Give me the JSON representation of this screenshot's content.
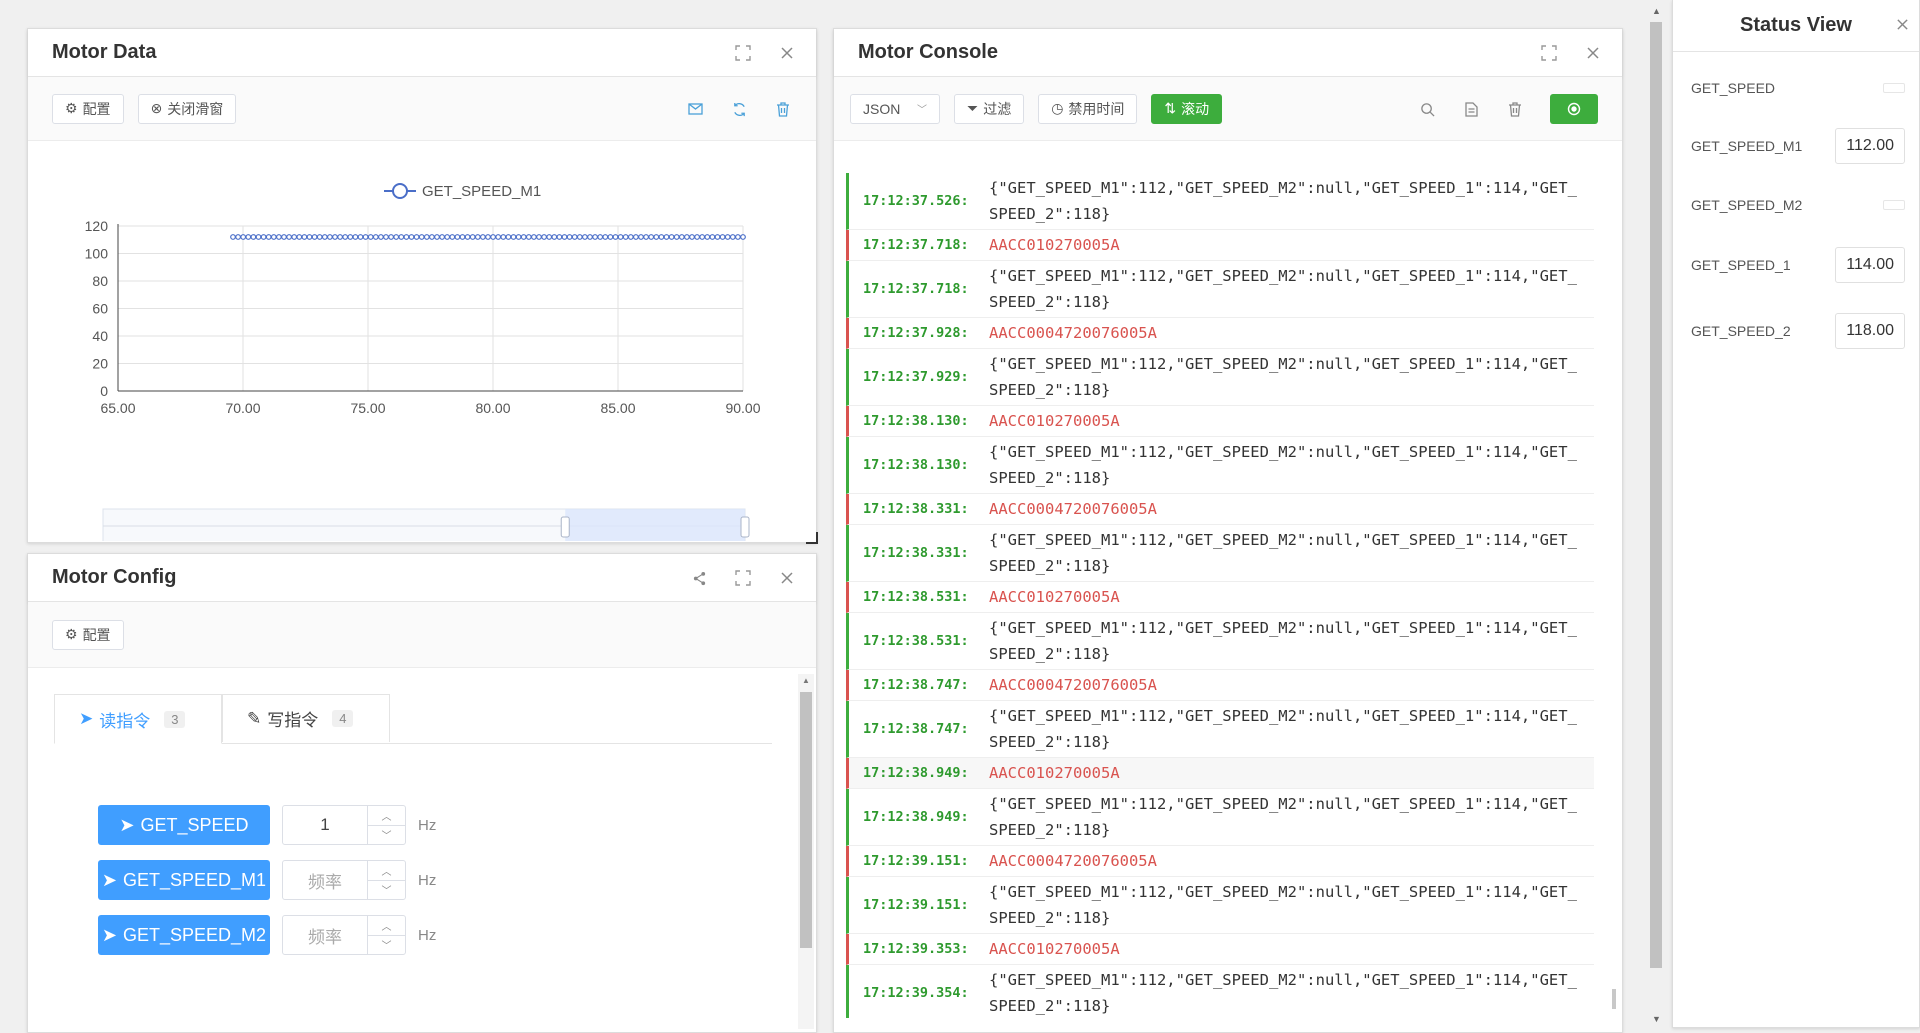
{
  "motor_data": {
    "title": "Motor Data",
    "btn_config": "配置",
    "btn_close_slider": "关闭滑窗"
  },
  "chart_data": {
    "type": "line",
    "legend": [
      "GET_SPEED_M1"
    ],
    "series": [
      {
        "name": "GET_SPEED_M1",
        "x_range": [
          69.6,
          90.0
        ],
        "value": 112,
        "points": 101
      }
    ],
    "xlim": [
      65,
      90
    ],
    "ylim": [
      0,
      120
    ],
    "x_ticks": [
      "65.00",
      "70.00",
      "75.00",
      "80.00",
      "85.00",
      "90.00"
    ],
    "y_ticks": [
      "0",
      "20",
      "40",
      "60",
      "80",
      "100",
      "120"
    ],
    "grid": true,
    "slider_range": [
      0.72,
      1.0
    ],
    "color": "#4a6ec8"
  },
  "motor_config": {
    "title": "Motor Config",
    "btn_config": "配置",
    "tabs": [
      {
        "label": "读指令",
        "count": "3"
      },
      {
        "label": "写指令",
        "count": "4"
      }
    ],
    "commands": [
      {
        "label": "GET_SPEED",
        "value": "1",
        "placeholder": "",
        "unit": "Hz"
      },
      {
        "label": "GET_SPEED_M1",
        "value": "",
        "placeholder": "频率",
        "unit": "Hz"
      },
      {
        "label": "GET_SPEED_M2",
        "value": "",
        "placeholder": "频率",
        "unit": "Hz"
      }
    ]
  },
  "console": {
    "title": "Motor Console",
    "format": "JSON",
    "btn_filter": "过滤",
    "btn_disable_time": "禁用时间",
    "btn_scroll": "滚动",
    "logs": [
      {
        "time": "17:12:37.526:",
        "msg": "{\"GET_SPEED_M1\":112,\"GET_SPEED_M2\":null,\"GET_SPEED_1\":114,\"GET_SPEED_2\":118}",
        "kind": "green"
      },
      {
        "time": "17:12:37.718:",
        "msg": "AACC010270005A",
        "kind": "red"
      },
      {
        "time": "17:12:37.718:",
        "msg": "{\"GET_SPEED_M1\":112,\"GET_SPEED_M2\":null,\"GET_SPEED_1\":114,\"GET_SPEED_2\":118}",
        "kind": "green"
      },
      {
        "time": "17:12:37.928:",
        "msg": "AACC0004720076005A",
        "kind": "red"
      },
      {
        "time": "17:12:37.929:",
        "msg": "{\"GET_SPEED_M1\":112,\"GET_SPEED_M2\":null,\"GET_SPEED_1\":114,\"GET_SPEED_2\":118}",
        "kind": "green"
      },
      {
        "time": "17:12:38.130:",
        "msg": "AACC010270005A",
        "kind": "red"
      },
      {
        "time": "17:12:38.130:",
        "msg": "{\"GET_SPEED_M1\":112,\"GET_SPEED_M2\":null,\"GET_SPEED_1\":114,\"GET_SPEED_2\":118}",
        "kind": "green"
      },
      {
        "time": "17:12:38.331:",
        "msg": "AACC0004720076005A",
        "kind": "red"
      },
      {
        "time": "17:12:38.331:",
        "msg": "{\"GET_SPEED_M1\":112,\"GET_SPEED_M2\":null,\"GET_SPEED_1\":114,\"GET_SPEED_2\":118}",
        "kind": "green"
      },
      {
        "time": "17:12:38.531:",
        "msg": "AACC010270005A",
        "kind": "red"
      },
      {
        "time": "17:12:38.531:",
        "msg": "{\"GET_SPEED_M1\":112,\"GET_SPEED_M2\":null,\"GET_SPEED_1\":114,\"GET_SPEED_2\":118}",
        "kind": "green"
      },
      {
        "time": "17:12:38.747:",
        "msg": "AACC0004720076005A",
        "kind": "red"
      },
      {
        "time": "17:12:38.747:",
        "msg": "{\"GET_SPEED_M1\":112,\"GET_SPEED_M2\":null,\"GET_SPEED_1\":114,\"GET_SPEED_2\":118}",
        "kind": "green"
      },
      {
        "time": "17:12:38.949:",
        "msg": "AACC010270005A",
        "kind": "red"
      },
      {
        "time": "17:12:38.949:",
        "msg": "{\"GET_SPEED_M1\":112,\"GET_SPEED_M2\":null,\"GET_SPEED_1\":114,\"GET_SPEED_2\":118}",
        "kind": "green"
      },
      {
        "time": "17:12:39.151:",
        "msg": "AACC0004720076005A",
        "kind": "red"
      },
      {
        "time": "17:12:39.151:",
        "msg": "{\"GET_SPEED_M1\":112,\"GET_SPEED_M2\":null,\"GET_SPEED_1\":114,\"GET_SPEED_2\":118}",
        "kind": "green"
      },
      {
        "time": "17:12:39.353:",
        "msg": "AACC010270005A",
        "kind": "red"
      },
      {
        "time": "17:12:39.354:",
        "msg": "{\"GET_SPEED_M1\":112,\"GET_SPEED_M2\":null,\"GET_SPEED_1\":114,\"GET_SPEED_2\":118}",
        "kind": "green"
      }
    ]
  },
  "status_view": {
    "title": "Status View",
    "rows": [
      {
        "label": "GET_SPEED",
        "value": ""
      },
      {
        "label": "GET_SPEED_M1",
        "value": "112.00"
      },
      {
        "label": "GET_SPEED_M2",
        "value": ""
      },
      {
        "label": "GET_SPEED_1",
        "value": "114.00"
      },
      {
        "label": "GET_SPEED_2",
        "value": "118.00"
      }
    ]
  },
  "colors": {
    "accent": "#409eff",
    "green": "#3dad3d",
    "red": "#d9534f"
  }
}
